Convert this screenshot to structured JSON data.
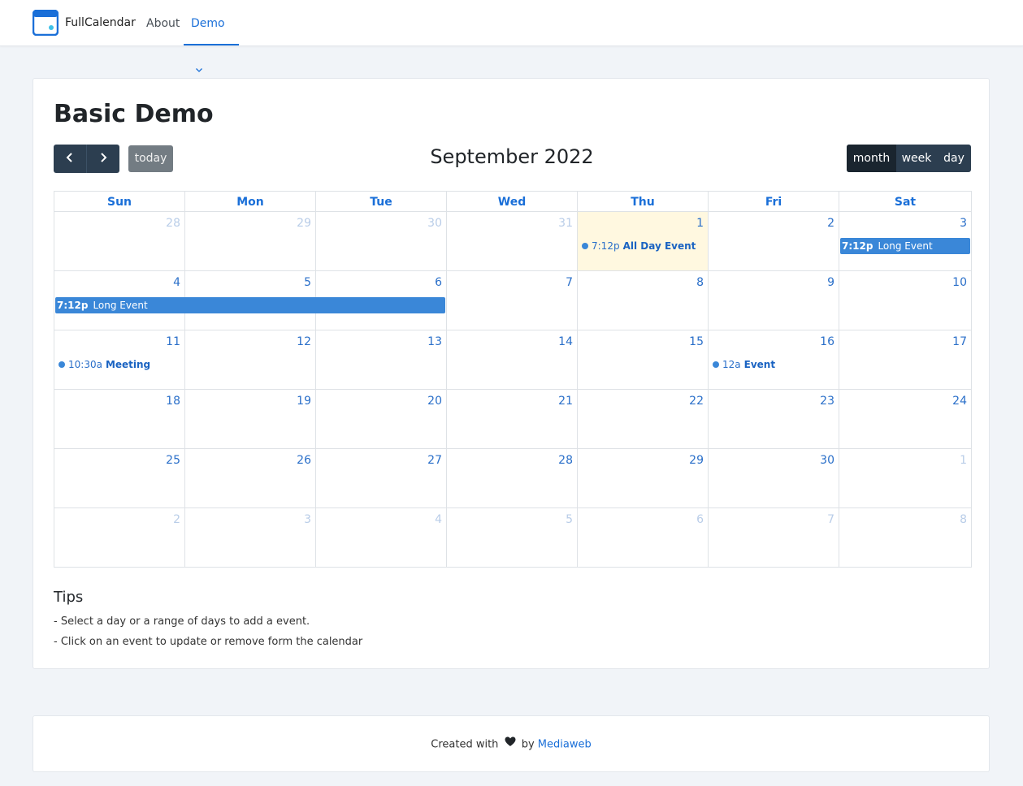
{
  "navbar": {
    "brand": "FullCalendar",
    "links": [
      {
        "label": "About"
      },
      {
        "label": "Demo",
        "active": true
      }
    ]
  },
  "page": {
    "title": "Basic Demo"
  },
  "calendar": {
    "title": "September 2022",
    "today_label": "today",
    "views": [
      "month",
      "week",
      "day"
    ],
    "active_view": "month",
    "weekdays": [
      "Sun",
      "Mon",
      "Tue",
      "Wed",
      "Thu",
      "Fri",
      "Sat"
    ],
    "weeks": [
      [
        {
          "n": "28",
          "other": true
        },
        {
          "n": "29",
          "other": true
        },
        {
          "n": "30",
          "other": true
        },
        {
          "n": "31",
          "other": true
        },
        {
          "n": "1",
          "today": true
        },
        {
          "n": "2"
        },
        {
          "n": "3"
        }
      ],
      [
        {
          "n": "4"
        },
        {
          "n": "5"
        },
        {
          "n": "6"
        },
        {
          "n": "7"
        },
        {
          "n": "8"
        },
        {
          "n": "9"
        },
        {
          "n": "10"
        }
      ],
      [
        {
          "n": "11"
        },
        {
          "n": "12"
        },
        {
          "n": "13"
        },
        {
          "n": "14"
        },
        {
          "n": "15"
        },
        {
          "n": "16"
        },
        {
          "n": "17"
        }
      ],
      [
        {
          "n": "18"
        },
        {
          "n": "19"
        },
        {
          "n": "20"
        },
        {
          "n": "21"
        },
        {
          "n": "22"
        },
        {
          "n": "23"
        },
        {
          "n": "24"
        }
      ],
      [
        {
          "n": "25"
        },
        {
          "n": "26"
        },
        {
          "n": "27"
        },
        {
          "n": "28"
        },
        {
          "n": "29"
        },
        {
          "n": "30"
        },
        {
          "n": "1",
          "other": true
        }
      ],
      [
        {
          "n": "2",
          "other": true
        },
        {
          "n": "3",
          "other": true
        },
        {
          "n": "4",
          "other": true
        },
        {
          "n": "5",
          "other": true
        },
        {
          "n": "6",
          "other": true
        },
        {
          "n": "7",
          "other": true
        },
        {
          "n": "8",
          "other": true
        }
      ]
    ],
    "events": [
      {
        "style": "dot",
        "time": "7:12p",
        "title": "All Day Event",
        "week": 0,
        "start": 4,
        "end": 4
      },
      {
        "style": "bar",
        "time": "7:12p",
        "title": "Long Event",
        "week": 0,
        "start": 6,
        "end": 6
      },
      {
        "style": "bar",
        "time": "7:12p",
        "title": "Long Event",
        "week": 1,
        "start": 0,
        "end": 2
      },
      {
        "style": "dot",
        "time": "10:30a",
        "title": "Meeting",
        "week": 2,
        "start": 0,
        "end": 0
      },
      {
        "style": "dot",
        "time": "12a",
        "title": "Event",
        "week": 2,
        "start": 5,
        "end": 5
      }
    ]
  },
  "tips": {
    "title": "Tips",
    "items": [
      "- Select a day or a range of days to add a event.",
      "- Click on an event to update or remove form the calendar"
    ]
  },
  "footer": {
    "prefix": "Created with",
    "by": "by",
    "link": "Mediaweb"
  },
  "colors": {
    "accent": "#1a6fd8",
    "event": "#3a87d8",
    "toolbar": "#2c3e50",
    "today_bg": "#fff8e0"
  }
}
